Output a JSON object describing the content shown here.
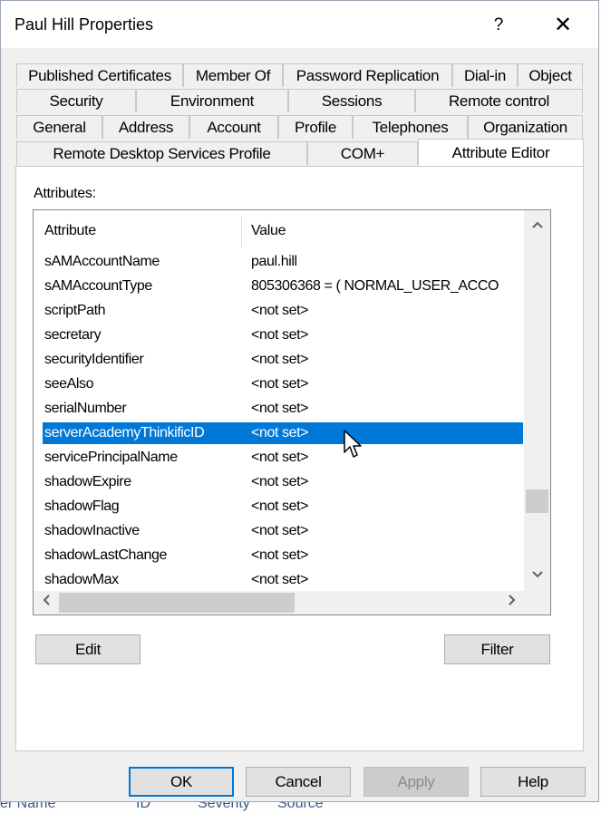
{
  "window": {
    "title": "Paul Hill Properties",
    "help_label": "?",
    "close_label": "✕"
  },
  "tabs": {
    "row1": [
      "Published Certificates",
      "Member Of",
      "Password Replication",
      "Dial-in",
      "Object"
    ],
    "row2": [
      "Security",
      "Environment",
      "Sessions",
      "Remote control"
    ],
    "row3": [
      "General",
      "Address",
      "Account",
      "Profile",
      "Telephones",
      "Organization"
    ],
    "row4": [
      "Remote Desktop Services Profile",
      "COM+",
      "Attribute Editor"
    ],
    "active": "Attribute Editor"
  },
  "attributes": {
    "label": "Attributes:",
    "col_attribute": "Attribute",
    "col_value": "Value",
    "rows": [
      {
        "attr": "sAMAccountName",
        "value": "paul.hill"
      },
      {
        "attr": "sAMAccountType",
        "value": "805306368 = ( NORMAL_USER_ACCO"
      },
      {
        "attr": "scriptPath",
        "value": "<not set>"
      },
      {
        "attr": "secretary",
        "value": "<not set>"
      },
      {
        "attr": "securityIdentifier",
        "value": "<not set>"
      },
      {
        "attr": "seeAlso",
        "value": "<not set>"
      },
      {
        "attr": "serialNumber",
        "value": "<not set>"
      },
      {
        "attr": "serverAcademyThinkificID",
        "value": "<not set>"
      },
      {
        "attr": "servicePrincipalName",
        "value": "<not set>"
      },
      {
        "attr": "shadowExpire",
        "value": "<not set>"
      },
      {
        "attr": "shadowFlag",
        "value": "<not set>"
      },
      {
        "attr": "shadowInactive",
        "value": "<not set>"
      },
      {
        "attr": "shadowLastChange",
        "value": "<not set>"
      },
      {
        "attr": "shadowMax",
        "value": "<not set>"
      }
    ],
    "selected_index": 7
  },
  "buttons": {
    "edit": "Edit",
    "filter": "Filter",
    "ok": "OK",
    "cancel": "Cancel",
    "apply": "Apply",
    "help": "Help"
  },
  "scroll_icons": {
    "up": "chevron-up-icon",
    "down": "chevron-down-icon",
    "left": "chevron-left-icon",
    "right": "chevron-right-icon"
  },
  "background_app": {
    "columns": [
      "er Name",
      "ID",
      "Severity",
      "Source"
    ]
  },
  "colors": {
    "selection": "#0078d7",
    "dialog_bg": "#f0f0f0",
    "default_button_border": "#0078d7"
  }
}
